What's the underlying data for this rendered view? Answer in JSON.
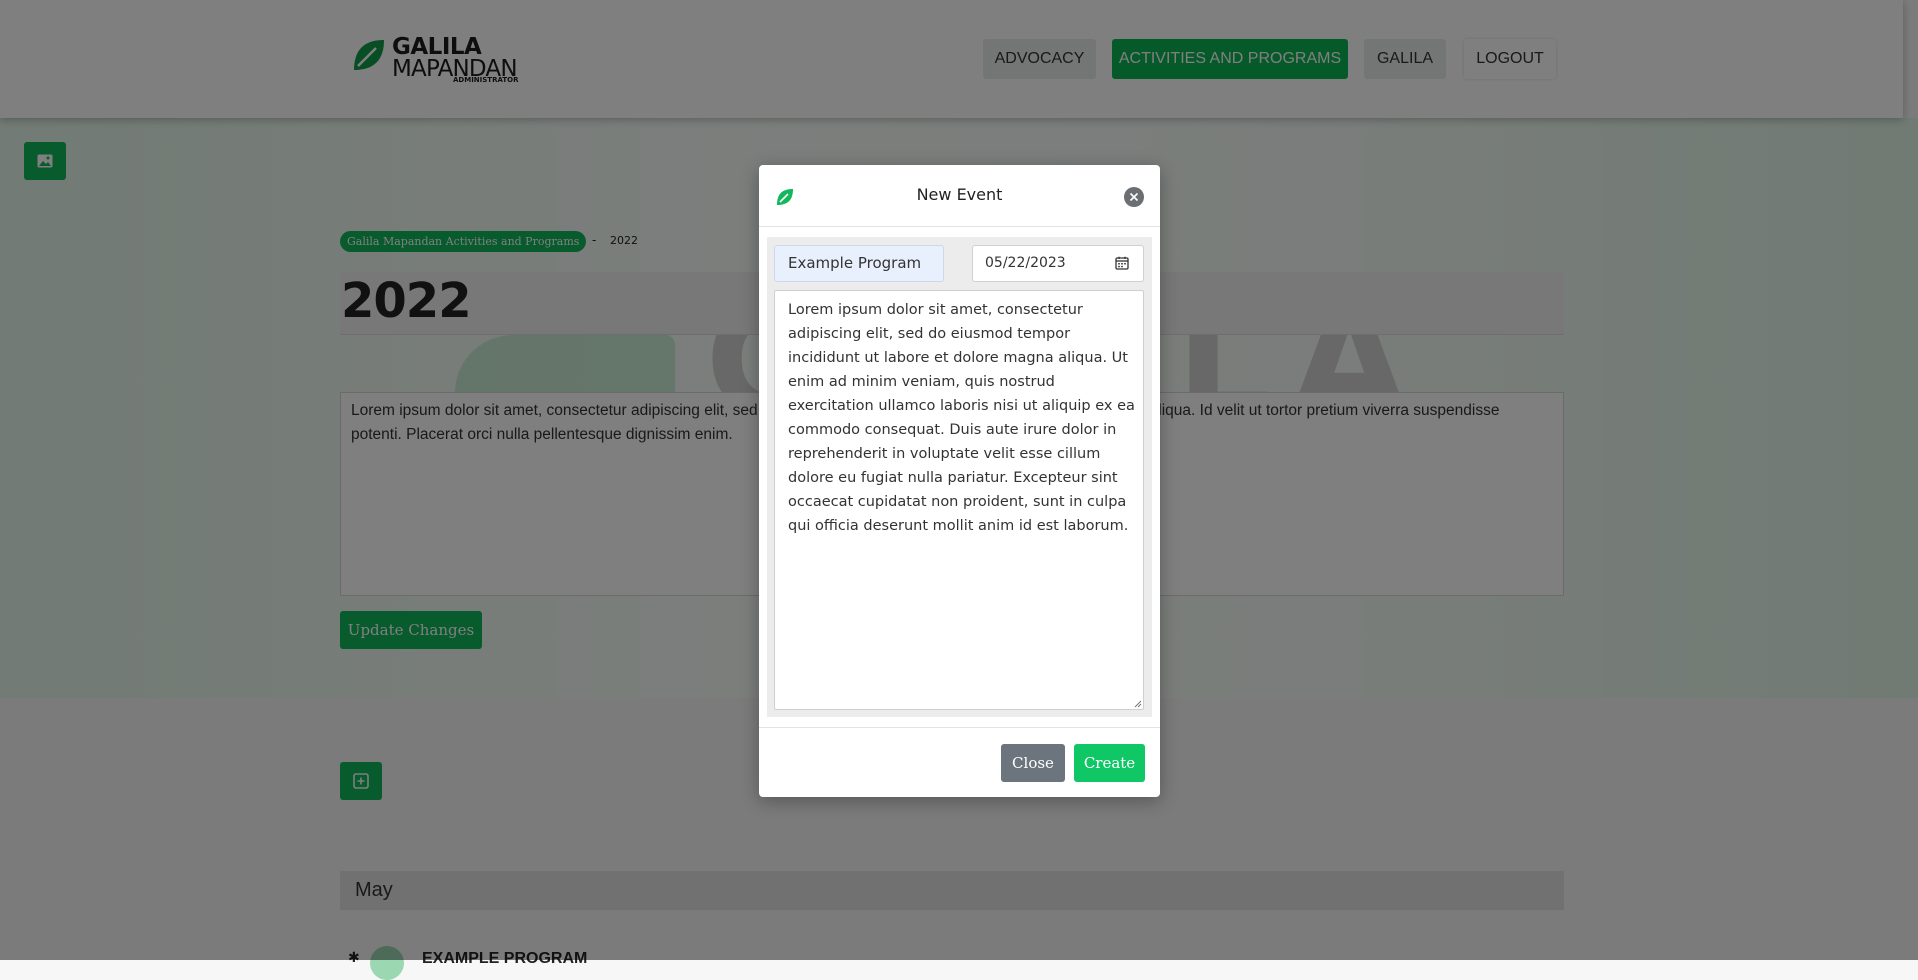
{
  "header": {
    "logo": {
      "line1": "GALILA",
      "line2": "MAPANDAN",
      "line3": "ADMINISTRATOR"
    },
    "nav": [
      {
        "label": "ADVOCACY"
      },
      {
        "label": "ACTIVITIES AND PROGRAMS"
      },
      {
        "label": "GALILA"
      },
      {
        "label": "LOGOUT"
      }
    ],
    "active_nav": "ACTIVITIES AND PROGRAMS"
  },
  "page": {
    "breadcrumb": {
      "parent": "Galila Mapandan Activities and Programs",
      "separator": "-",
      "current": "2022"
    },
    "year_title": "2022",
    "background_logo_text": "GALILA",
    "description": "Lorem ipsum dolor sit amet, consectetur adipiscing elit, sed do eiusmod tempor incididunt ut labore et dolore magna aliqua. Id velit ut tortor pretium viverra suspendisse potenti. Placerat orci nulla pellentesque dignissim enim.",
    "update_button": "Update Changes",
    "month_heading": "May",
    "event_title": "EXAMPLE PROGRAM"
  },
  "modal": {
    "title": "New Event",
    "event_name_value": "Example Program",
    "date_value": "05/22/2023",
    "description_value": "Lorem ipsum dolor sit amet, consectetur adipiscing elit, sed do eiusmod tempor incididunt ut labore et dolore magna aliqua. Ut enim ad minim veniam, quis nostrud exercitation ullamco laboris nisi ut aliquip ex ea commodo consequat. Duis aute irure dolor in reprehenderit in voluptate velit esse cillum dolore eu fugiat nulla pariatur. Excepteur sint occaecat cupidatat non proident, sunt in culpa qui officia deserunt mollit anim id est laborum.",
    "close_button": "Close",
    "create_button": "Create"
  },
  "colors": {
    "brand_green": "#0fb659",
    "create_green": "#10c766",
    "close_gray": "#6c757d",
    "overlay": "rgba(0,0,0,0.5)"
  },
  "icons": [
    "leaf-logo-icon",
    "image-icon",
    "plus-square-icon",
    "close-circle-icon",
    "calendar-icon",
    "resize-grip-icon"
  ]
}
